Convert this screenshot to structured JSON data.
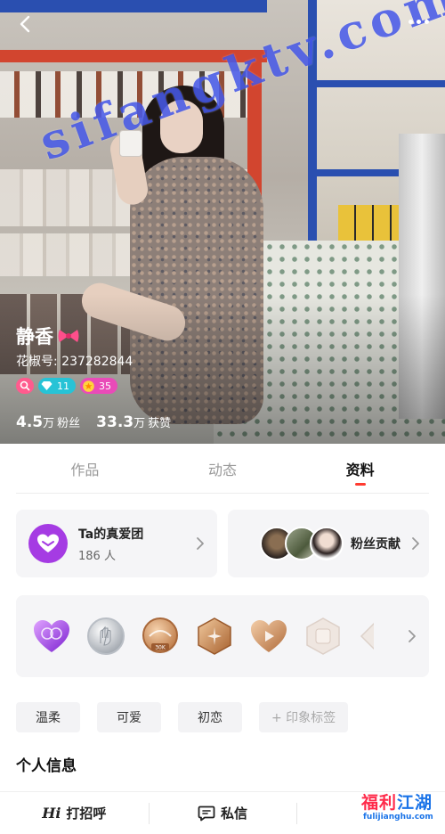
{
  "watermark": "sifangktv.com",
  "profile": {
    "name": "静香",
    "id_label": "花椒号: 237282844",
    "badges": {
      "diamond": "11",
      "star": "35"
    },
    "stats": [
      {
        "num": "4.5",
        "unit": "万",
        "label": "粉丝"
      },
      {
        "num": "33.3",
        "unit": "万",
        "label": "获赞"
      }
    ]
  },
  "tabs": [
    {
      "label": "作品",
      "active": false
    },
    {
      "label": "动态",
      "active": false
    },
    {
      "label": "资料",
      "active": true
    }
  ],
  "fan_club": {
    "title": "Ta的真爱团",
    "count": "186 人"
  },
  "contributors": {
    "label": "粉丝贡献"
  },
  "medals": [
    "heart-purple-medal-icon",
    "silver-hand-medal-icon",
    "bronze-30k-medal-icon",
    "bronze-hexagon-medal-icon",
    "bronze-heart-medal-icon",
    "pale-hexagon-medal-icon",
    "pale-diamond-medal-icon"
  ],
  "tags": [
    "温柔",
    "可爱",
    "初恋"
  ],
  "add_tag": "+ 印象标签",
  "section_title": "个人信息",
  "bottom_bar": {
    "greet": "打招呼",
    "greet_prefix": "Hi",
    "message": "私信"
  },
  "site_logo": {
    "part1": "福利",
    "part2": "江湖",
    "url": "fulijianghu.com"
  },
  "colors": {
    "accent_red": "#ff3b30",
    "fan_purple": "#a53be3",
    "diamond": "#27c3d6",
    "star": "#e94bb8",
    "watermark": "#3246e6"
  }
}
